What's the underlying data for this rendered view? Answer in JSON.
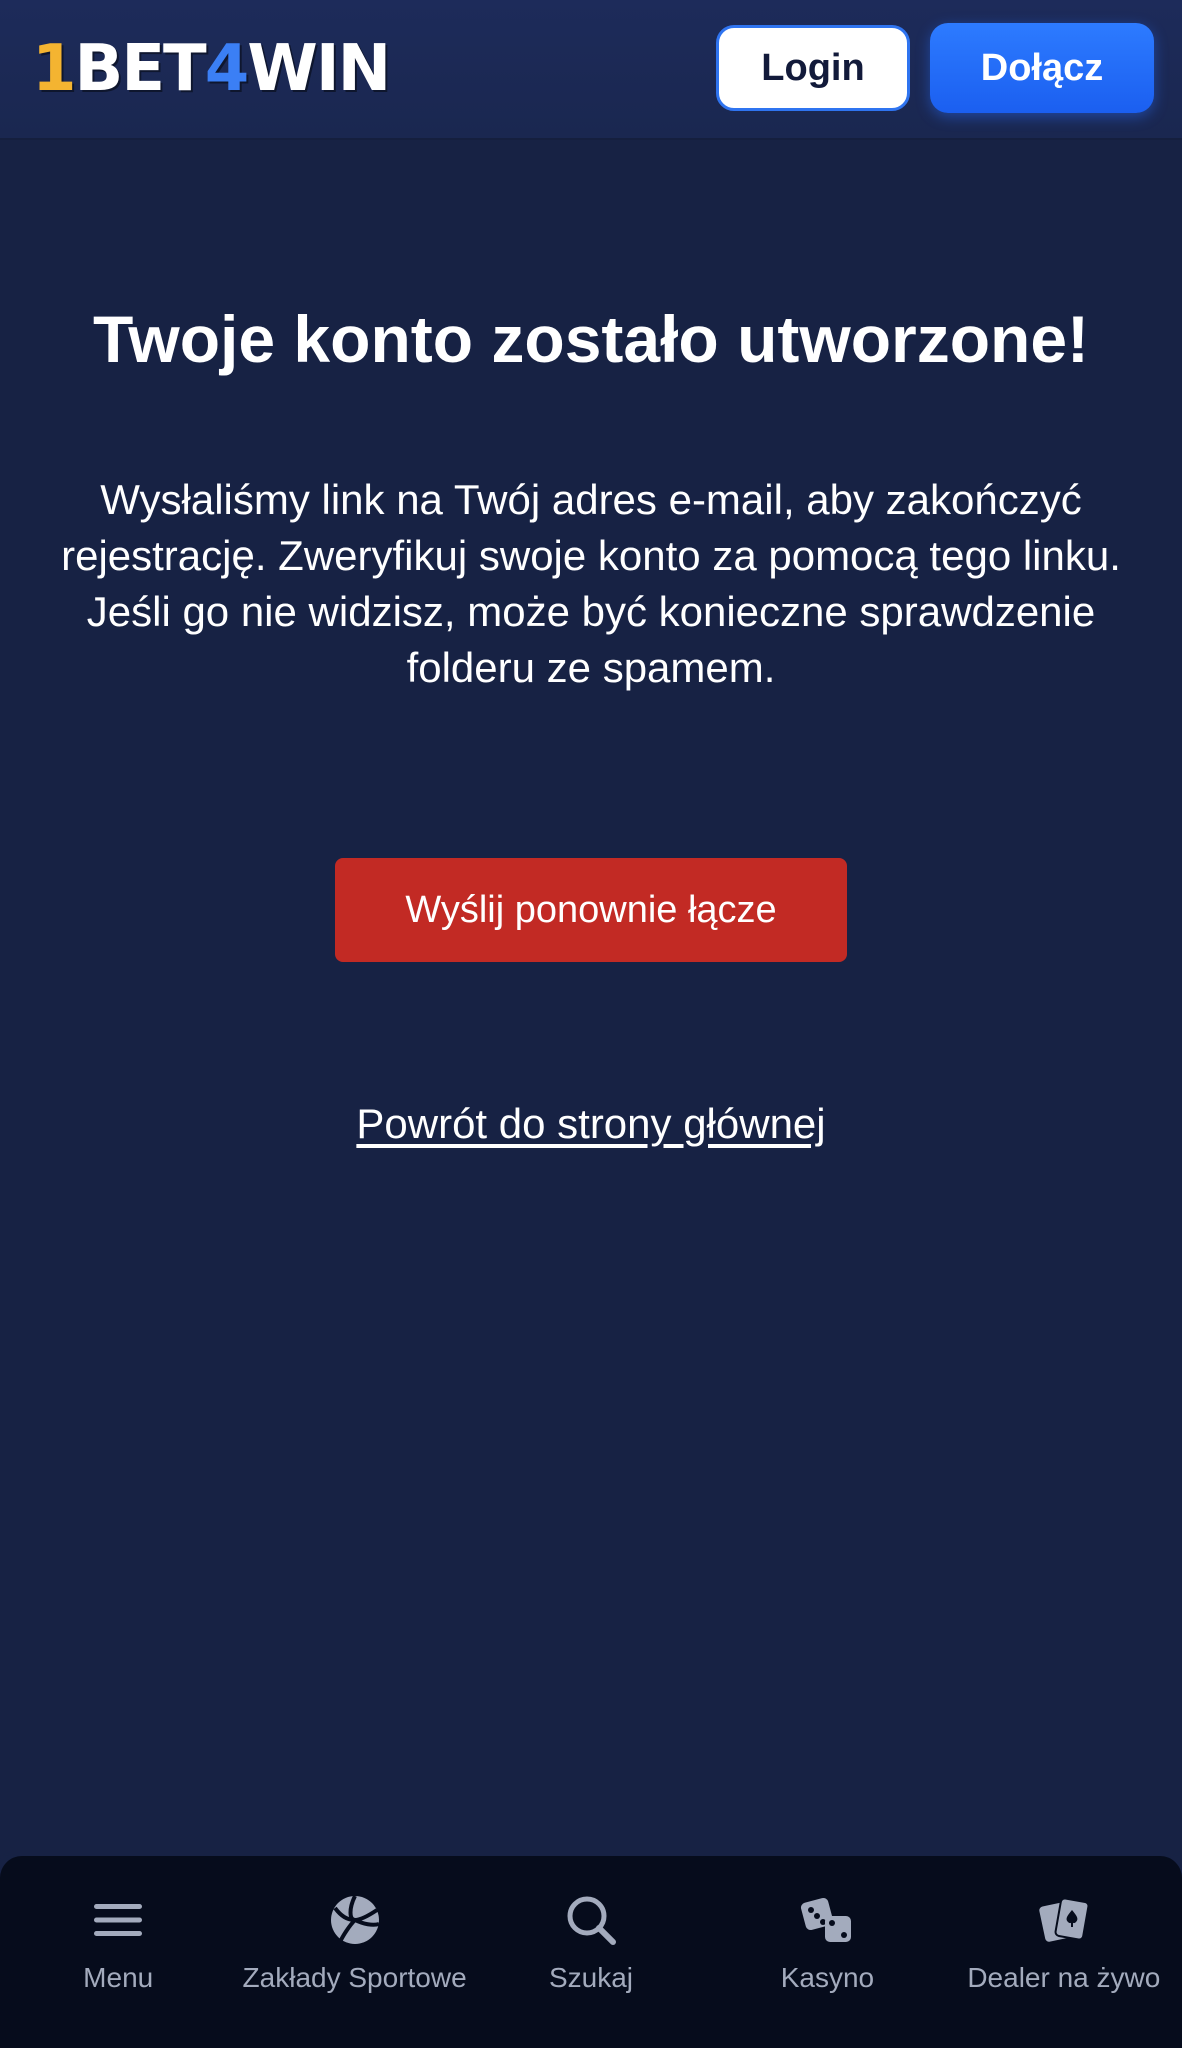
{
  "header": {
    "logo": {
      "part1": "1",
      "part2": "BET",
      "part3": "4",
      "part4": "WIN"
    },
    "login_label": "Login",
    "join_label": "Dołącz"
  },
  "main": {
    "title": "Twoje konto zostało utworzone!",
    "message": "Wysłaliśmy link na Twój adres e-mail, aby zakończyć rejestrację. Zweryfikuj swoje konto za pomocą tego linku. Jeśli go nie widzisz, może być konieczne sprawdzenie folderu ze spamem.",
    "resend_label": "Wyślij ponownie łącze",
    "home_link_label": "Powrót do strony głównej"
  },
  "bottom_nav": {
    "items": [
      {
        "label": "Menu",
        "icon": "menu-icon"
      },
      {
        "label": "Zakłady Sportowe",
        "icon": "volleyball-icon"
      },
      {
        "label": "Szukaj",
        "icon": "search-icon"
      },
      {
        "label": "Kasyno",
        "icon": "dice-icon"
      },
      {
        "label": "Dealer na żywo",
        "icon": "cards-icon"
      }
    ]
  },
  "colors": {
    "background": "#172244",
    "header": "#1d2b5a",
    "accent_blue": "#2d7bff",
    "resend_red": "#c22a24",
    "logo_gold": "#f4b431",
    "nav_background": "#060c1c",
    "nav_text": "#a3abbd"
  }
}
